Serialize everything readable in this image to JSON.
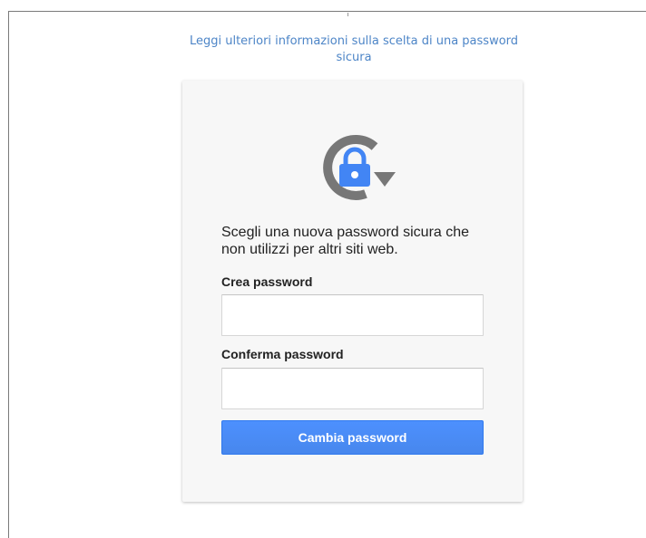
{
  "help_link": {
    "label": "Leggi ulteriori informazioni sulla scelta di una password sicura"
  },
  "card": {
    "icon": "lock-refresh-icon",
    "lead_text": "Scegli una nuova password sicura che non utilizzi per altri siti web.",
    "create_label": "Crea password",
    "create_value": "",
    "confirm_label": "Conferma password",
    "confirm_value": "",
    "submit_label": "Cambia password"
  },
  "colors": {
    "link": "#4d85c7",
    "accent": "#4d90fe",
    "icon_ring": "#777777",
    "lock_blue": "#4285f4"
  }
}
